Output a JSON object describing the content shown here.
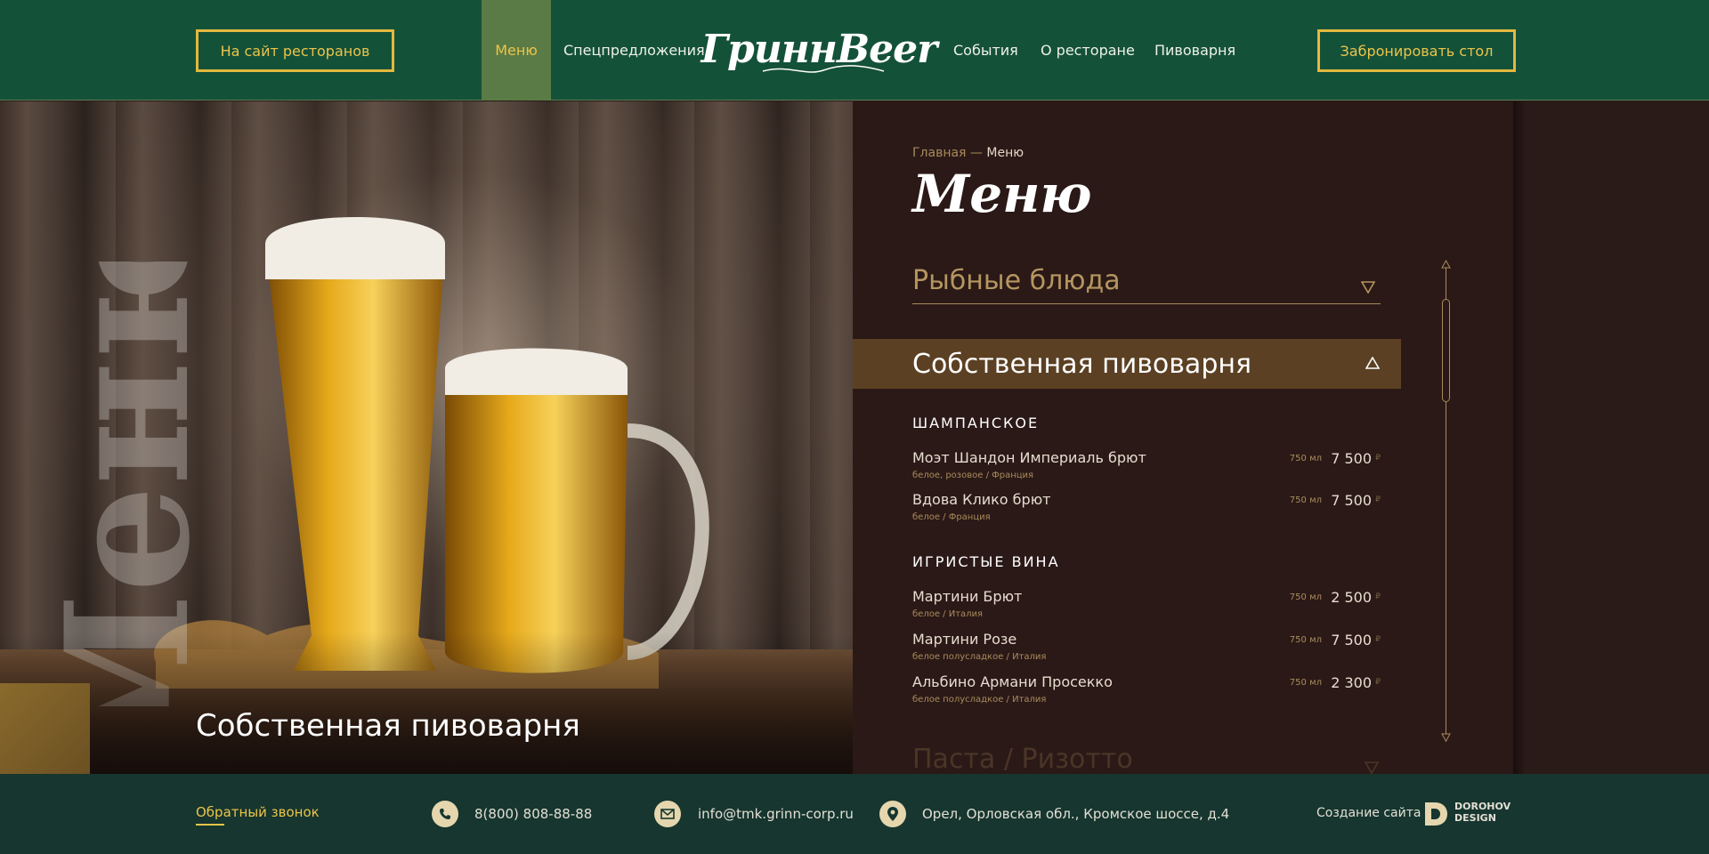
{
  "header": {
    "sites_button": "На сайт ресторанов",
    "book_button": "Забронировать стол",
    "nav": {
      "menu": "Меню",
      "special": "Спецпредложения",
      "events": "События",
      "about": "О ресторане",
      "brewery": "Пивоварня"
    },
    "logo": "ГриннBeer"
  },
  "hero": {
    "caption": "Собственная пивоварня",
    "vertical_word": "Меню"
  },
  "menu": {
    "breadcrumb_home": "Главная",
    "breadcrumb_sep": " — ",
    "breadcrumb_current": "Меню",
    "title": "Меню",
    "categories": {
      "fish": "Рыбные блюда",
      "brewery": "Собственная пивоварня",
      "pasta": "Паста / Ризотто"
    },
    "sections": [
      {
        "title": "ШАМПАНСКОЕ",
        "items": [
          {
            "name": "Моэт Шандон Империаль брют",
            "desc": "белое, розовое / Франция",
            "vol": "750 мл",
            "price": "7 500"
          },
          {
            "name": "Вдова Клико брют",
            "desc": "белое / Франция",
            "vol": "750 мл",
            "price": "7 500"
          }
        ]
      },
      {
        "title": "ИГРИСТЫЕ ВИНА",
        "items": [
          {
            "name": "Мартини Брют",
            "desc": "белое / Италия",
            "vol": "750 мл",
            "price": "2 500"
          },
          {
            "name": "Мартини Розе",
            "desc": "белое полусладкое / Италия",
            "vol": "750 мл",
            "price": "7 500"
          },
          {
            "name": "Альбино Армани Просекко",
            "desc": "белое полусладкое / Италия",
            "vol": "750 мл",
            "price": "2 300"
          }
        ]
      }
    ],
    "currency": "₽"
  },
  "footer": {
    "callback": "Обратный звонок",
    "phone": "8(800) 808-88-88",
    "email": "info@tmk.grinn-corp.ru",
    "address": "Орел, Орловская обл., Кромское шоссе, д.4",
    "credit": "Создание сайта -",
    "studio_line1": "DOROHOV",
    "studio_line2": "DESIGN"
  },
  "colors": {
    "header_green": "#145139",
    "accent_gold": "#ecc44a",
    "panel_brown": "#2b1917",
    "active_category": "#5b4023",
    "footer_green": "#16362f"
  },
  "icons": [
    "phone-icon",
    "mail-icon",
    "location-icon",
    "triangle-down-icon",
    "triangle-up-icon",
    "dorohov-design-logo"
  ]
}
